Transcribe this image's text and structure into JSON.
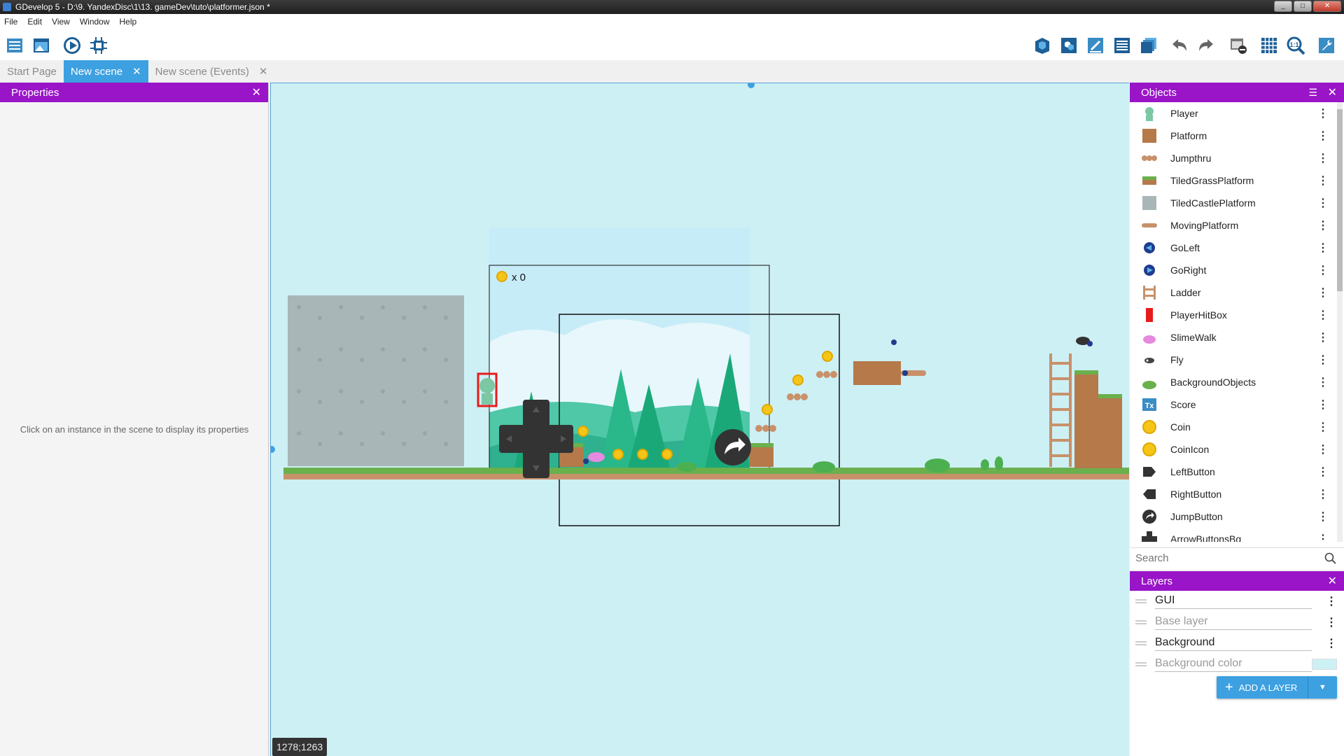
{
  "window": {
    "title": "GDevelop 5 - D:\\9. YandexDisc\\1\\13. gameDev\\tuto\\platformer.json *",
    "controls": [
      "_",
      "□",
      "✕"
    ]
  },
  "menu": [
    "File",
    "Edit",
    "View",
    "Window",
    "Help"
  ],
  "toolbar": {
    "left": [
      "project-manager-icon",
      "scene-editor-icon",
      "preview-play-icon",
      "debugger-icon"
    ],
    "right": [
      "objects-panel-icon",
      "object-groups-icon",
      "properties-panel-icon",
      "instances-list-icon",
      "layers-panel-icon",
      "undo-icon",
      "redo-icon",
      "delete-icon",
      "grid-icon",
      "zoom-icon",
      "settings-icon"
    ]
  },
  "tabs": [
    {
      "label": "Start Page",
      "closable": false,
      "active": false
    },
    {
      "label": "New scene",
      "closable": true,
      "active": true
    },
    {
      "label": "New scene (Events)",
      "closable": true,
      "active": false
    }
  ],
  "properties": {
    "title": "Properties",
    "hint": "Click on an instance in the scene to display its properties"
  },
  "scene": {
    "coords": "1278;1263",
    "hud_score": "x 0",
    "background_color": "#cdf0f5"
  },
  "objects": {
    "title": "Objects",
    "items": [
      {
        "name": "Player",
        "icon": "player-icon",
        "color": "#7cc7a4"
      },
      {
        "name": "Platform",
        "icon": "platform-icon",
        "color": "#b5794a"
      },
      {
        "name": "Jumpthru",
        "icon": "jumpthru-icon",
        "color": "#c8916a"
      },
      {
        "name": "TiledGrassPlatform",
        "icon": "grass-icon",
        "color": "#6ab04c"
      },
      {
        "name": "TiledCastlePlatform",
        "icon": "castle-icon",
        "color": "#a9b6b8"
      },
      {
        "name": "MovingPlatform",
        "icon": "moving-platform-icon",
        "color": "#c8916a"
      },
      {
        "name": "GoLeft",
        "icon": "goleft-icon",
        "color": "#1f3c8f"
      },
      {
        "name": "GoRight",
        "icon": "goright-icon",
        "color": "#1f3c8f"
      },
      {
        "name": "Ladder",
        "icon": "ladder-icon",
        "color": "#c8916a"
      },
      {
        "name": "PlayerHitBox",
        "icon": "hitbox-icon",
        "color": "#e61c1c"
      },
      {
        "name": "SlimeWalk",
        "icon": "slime-icon",
        "color": "#e58ae0"
      },
      {
        "name": "Fly",
        "icon": "fly-icon",
        "color": "#444444"
      },
      {
        "name": "BackgroundObjects",
        "icon": "bush-icon",
        "color": "#6ab04c"
      },
      {
        "name": "Score",
        "icon": "text-icon",
        "color": "#3a8cc4"
      },
      {
        "name": "Coin",
        "icon": "coin-icon",
        "color": "#f5c518"
      },
      {
        "name": "CoinIcon",
        "icon": "coin-icon",
        "color": "#f5c518"
      },
      {
        "name": "LeftButton",
        "icon": "left-button-icon",
        "color": "#333333"
      },
      {
        "name": "RightButton",
        "icon": "right-button-icon",
        "color": "#333333"
      },
      {
        "name": "JumpButton",
        "icon": "jump-button-icon",
        "color": "#333333"
      },
      {
        "name": "ArrowButtonsBg",
        "icon": "cross-icon",
        "color": "#333333"
      }
    ],
    "search_placeholder": "Search"
  },
  "layers": {
    "title": "Layers",
    "items": [
      {
        "name": "GUI",
        "dim": false
      },
      {
        "name": "Base layer",
        "dim": true
      },
      {
        "name": "Background",
        "dim": false
      }
    ],
    "background_color_label": "Background color",
    "add_label": "ADD A LAYER"
  },
  "colors": {
    "accent": "#9a14c8",
    "tab_active": "#3da0e0",
    "scene_bg": "#cdf0f5"
  }
}
